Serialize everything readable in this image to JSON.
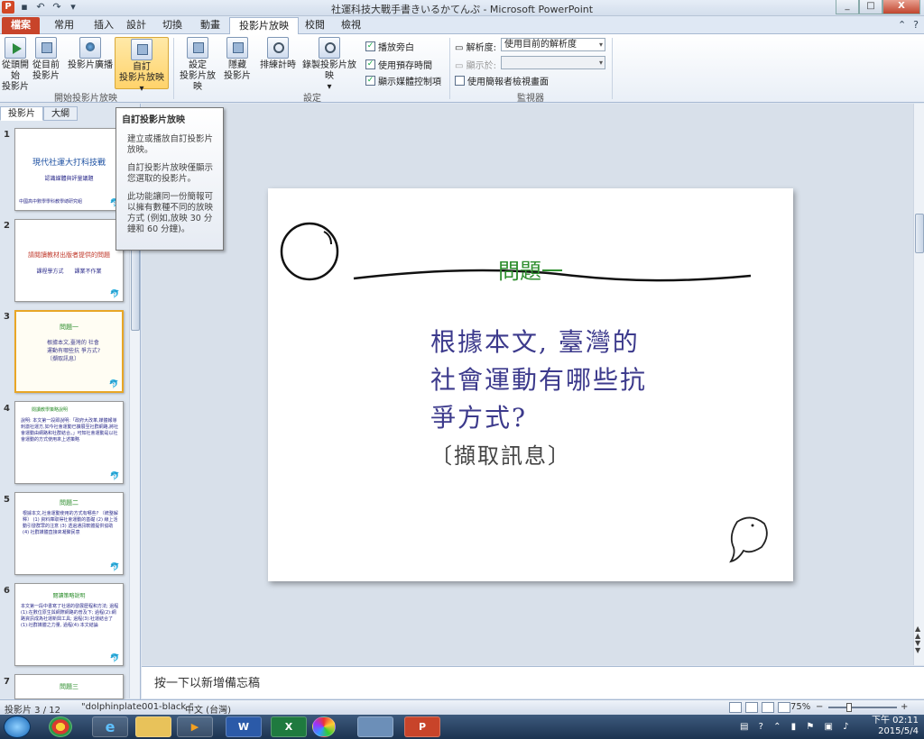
{
  "window": {
    "title": "社運科技大戰手書きいるかてんぷ - Microsoft PowerPoint",
    "min": "_",
    "max": "□",
    "close": "X"
  },
  "tabs": [
    "檔案",
    "常用",
    "插入",
    "設計",
    "切換",
    "動畫",
    "投影片放映",
    "校閱",
    "檢視"
  ],
  "ribbon": {
    "buttons": {
      "from_start": [
        "從頭開始",
        "投影片"
      ],
      "from_current": [
        "從目前",
        "投影片"
      ],
      "broadcast": "投影片廣播",
      "custom": [
        "自訂",
        "投影片放映 ▾"
      ],
      "setup": [
        "設定",
        "投影片放映"
      ],
      "hide": [
        "隱藏",
        "投影片"
      ],
      "rehearse": "排練計時",
      "record": [
        "錄製投影片放映",
        "▾"
      ]
    },
    "group_start": "開始投影片放映",
    "group_setup": "設定",
    "group_monitors": "監視器",
    "checks": {
      "narration": "播放旁白",
      "timings": "使用預存時間",
      "media_controls": "顯示媒體控制項",
      "presenter": "使用簡報者檢視畫面"
    },
    "resolution_label": "解析度:",
    "resolution_value": "使用目前的解析度",
    "show_on_label": "顯示於:"
  },
  "panel_tabs": [
    "投影片",
    "大綱"
  ],
  "panel_close": "x",
  "thumbnails": [
    {
      "num": "1",
      "title": "現代社運大打科技戰",
      "sub": "認識媒體與評量議題",
      "foot": "中國高中數學學科教學總研究組"
    },
    {
      "num": "2",
      "title": "請閱讀教材出版者提供的問題",
      "sub": "課程學方式　　課業不作業"
    },
    {
      "num": "3",
      "title": "問題一",
      "body": "根據本文,臺灣的 社會運動有哪些抗 爭方式? 〔擷取訊息〕"
    },
    {
      "num": "4",
      "title": "閱讀教學策略說明",
      "body": "說明: 本文第一段即說明:「政府大改革,媒體報導刺激社運方,如今社會運動已擴展至社群網路,將社會運動由網路和社群結合。」可知社會運動是以社會運動的方式使用來上述策略"
    },
    {
      "num": "5",
      "title": "問題二",
      "body": "根據本文,社會運動使用的方式有哪些? 〔統整解釋〕 (1) 資料庫取得社會運動的基礎 (2) 線上活動引發群眾的注意 (3) 透過通訊軟體提供協助 (4) 社群媒體直接來凝聚民意"
    },
    {
      "num": "6",
      "title": "閱讀策略說明",
      "body": "本文第一段中書寫了社運的發展歷程和方法; 過程(1):在數位原生與網際網路的普及下; 過程(2):網路資訊成為社運新興工具; 過程(3):社運結合了(1):社群媒體之力量, 過程(4):本文結論"
    },
    {
      "num": "7",
      "title": "問題三",
      "body": ""
    }
  ],
  "tooltip": {
    "title": "自訂投影片放映",
    "p1": "建立或播放自訂投影片放映。",
    "p2": "自訂投影片放映僅顯示您選取的投影片。",
    "p3": "此功能讓同一份簡報可以擁有數種不同的放映方式 (例如,放映 30 分鐘和 60 分鐘)。"
  },
  "slide": {
    "title": "問題一",
    "line1": "根據本文, 臺灣的",
    "line2": "社會運動有哪些抗",
    "line3": "爭方式?",
    "tag": "〔擷取訊息〕"
  },
  "notes_placeholder": "按一下以新增備忘稿",
  "status": {
    "slide_count": "投影片 3 / 12",
    "theme": "\"dolphinplate001-black-\"",
    "language": "中文 (台灣)",
    "zoom": "75%",
    "zoom_out": "−",
    "zoom_in": "+"
  },
  "taskbar": {
    "time": "下午 02:11",
    "date": "2015/5/4",
    "apps": [
      "",
      "",
      "e",
      "",
      "▶",
      "W",
      "X",
      "",
      "",
      "P"
    ]
  },
  "colors": {
    "accent": "#c8442a",
    "slide_title": "#2f8f2f",
    "slide_body": "#3c3a8c"
  }
}
